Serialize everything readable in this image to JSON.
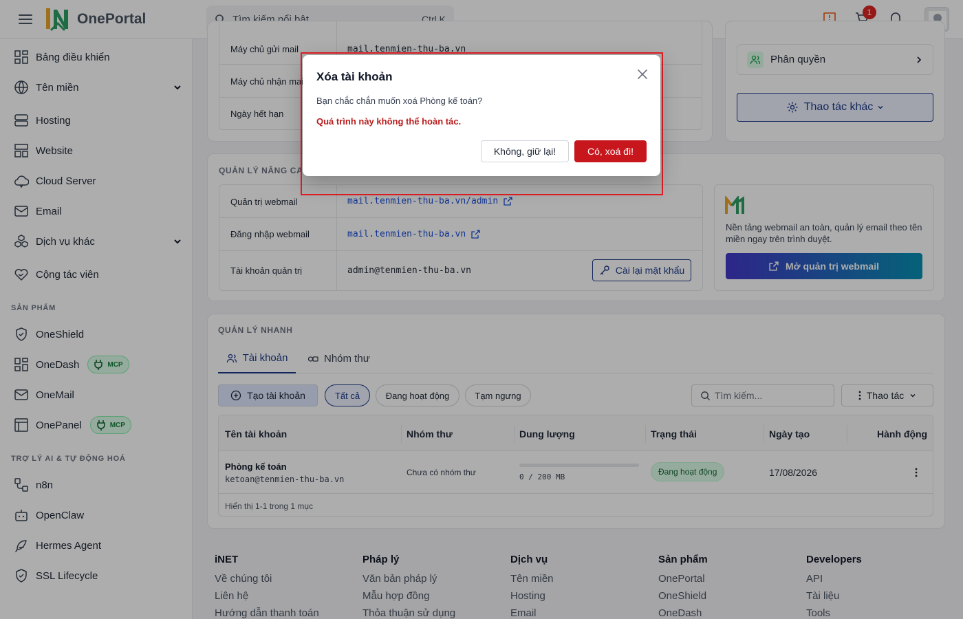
{
  "header": {
    "brand": "OnePortal",
    "search_placeholder": "Tìm kiếm nổi bật",
    "search_shortcut": "Ctrl K",
    "cart_count": "1"
  },
  "sidebar": {
    "items": [
      {
        "label": "Bảng điều khiển"
      },
      {
        "label": "Tên miền"
      },
      {
        "label": "Hosting"
      },
      {
        "label": "Website"
      },
      {
        "label": "Cloud Server"
      },
      {
        "label": "Email"
      },
      {
        "label": "Dịch vụ khác"
      },
      {
        "label": "Cộng tác viên"
      }
    ],
    "section_products": "SẢN PHẨM",
    "products": [
      {
        "label": "OneShield"
      },
      {
        "label": "OneDash",
        "badge": "MCP"
      },
      {
        "label": "OneMail"
      },
      {
        "label": "OnePanel",
        "badge": "MCP"
      }
    ],
    "section_ai": "TRỢ LÝ AI & TỰ ĐỘNG HOÁ",
    "ai": [
      {
        "label": "n8n"
      },
      {
        "label": "OpenClaw"
      },
      {
        "label": "Hermes Agent"
      },
      {
        "label": "SSL Lifecycle"
      }
    ]
  },
  "top_info": {
    "rows": [
      {
        "label": "Máy chủ gửi mail",
        "value": "mail.tenmien-thu-ba.vn"
      },
      {
        "label": "Máy chủ nhận mail",
        "value": ""
      },
      {
        "label": "Ngày hết hạn",
        "value": ""
      }
    ],
    "permission_label": "Phân quyền",
    "more_actions_label": "Thao tác khác"
  },
  "advanced": {
    "title": "QUẢN LÝ NÂNG CAO",
    "rows": [
      {
        "label": "Quản trị webmail",
        "value": "mail.tenmien-thu-ba.vn/admin"
      },
      {
        "label": "Đăng nhập webmail",
        "value": "mail.tenmien-thu-ba.vn"
      },
      {
        "label": "Tài khoản quản trị",
        "value": "admin@tenmien-thu-ba.vn"
      }
    ],
    "reset_password_label": "Cài lại mật khẩu",
    "promo_text": "Nền tảng webmail an toàn, quản lý email theo tên miền ngay trên trình duyệt.",
    "open_webmail_label": "Mở quản trị webmail"
  },
  "quick": {
    "title": "QUẢN LÝ NHANH",
    "tabs": [
      {
        "label": "Tài khoản"
      },
      {
        "label": "Nhóm thư"
      }
    ],
    "create_label": "Tạo tài khoản",
    "filters": [
      {
        "label": "Tất cả"
      },
      {
        "label": "Đang hoạt động"
      },
      {
        "label": "Tạm ngưng"
      }
    ],
    "search_placeholder": "Tìm kiếm...",
    "actions_label": "Thao tác",
    "columns": [
      "Tên tài khoản",
      "Nhóm thư",
      "Dung lượng",
      "Trạng thái",
      "Ngày tạo",
      "Hành động"
    ],
    "rows": [
      {
        "name": "Phòng kế toán",
        "email": "ketoan@tenmien-thu-ba.vn",
        "group": "Chưa có nhóm thư",
        "usage": "0 / 200 MB",
        "usage_fraction": 0,
        "status": "Đang hoạt động",
        "created": "17/08/2026"
      }
    ],
    "summary": "Hiển thị 1-1 trong 1 mục"
  },
  "footer": {
    "cols": [
      {
        "title": "iNET",
        "links": [
          "Về chúng tôi",
          "Liên hệ",
          "Hướng dẫn thanh toán"
        ]
      },
      {
        "title": "Pháp lý",
        "links": [
          "Văn bản pháp lý",
          "Mẫu hợp đồng",
          "Thỏa thuận sử dụng"
        ]
      },
      {
        "title": "Dịch vụ",
        "links": [
          "Tên miền",
          "Hosting",
          "Email"
        ]
      },
      {
        "title": "Sản phẩm",
        "links": [
          "OnePortal",
          "OneShield",
          "OneDash"
        ]
      },
      {
        "title": "Developers",
        "links": [
          "API",
          "Tài liệu",
          "Tools"
        ]
      }
    ]
  },
  "modal": {
    "title": "Xóa tài khoản",
    "message": "Bạn chắc chắn muốn xoá Phòng kế toán?",
    "warning": "Quá trình này không thể hoàn tác.",
    "cancel_label": "Không, giữ lại!",
    "confirm_label": "Có, xoá đi!"
  },
  "colors": {
    "primary": "#1e3a8a",
    "danger": "#c8161d",
    "highlight": "#e11d24",
    "success_bg": "#dcfce7"
  }
}
